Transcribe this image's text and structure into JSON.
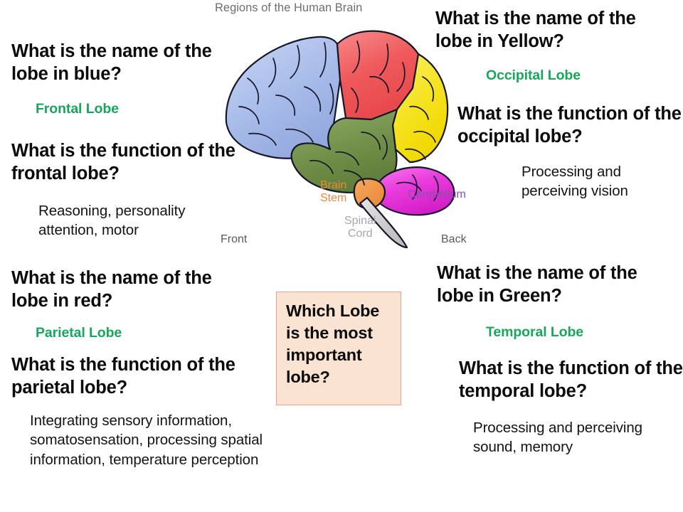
{
  "figure": {
    "title": "Regions of the Human Brain",
    "labels": {
      "brain_stem": "Brain\nStem",
      "brain_stem_line1": "Brain",
      "brain_stem_line2": "Stem",
      "spinal_cord_line1": "Spinal",
      "spinal_cord_line2": "Cord",
      "cerebellum": "Cerebellum",
      "front": "Front",
      "back": "Back"
    },
    "colors": {
      "frontal_lobe": "#a8bdea",
      "parietal_lobe": "#ef5a5c",
      "occipital_lobe": "#f6e426",
      "temporal_lobe": "#72914a",
      "cerebellum": "#ea3ede",
      "brain_stem": "#f0943f",
      "spinal_cord": "#cfcfcf",
      "outline": "#1a1a2e"
    }
  },
  "accent_colors": {
    "answer_green": "#16a75c",
    "callout_bg": "#fbe3d2",
    "callout_border": "#e8a294"
  },
  "left_column": {
    "blocks": [
      {
        "question": "What is the name of the lobe in blue?",
        "answer": "Frontal Lobe",
        "answer_kind": "lobe-name"
      },
      {
        "question": "What is the function of the frontal lobe?",
        "answer": "Reasoning, personality attention, motor",
        "answer_kind": "function"
      },
      {
        "question": "What is the name of the lobe in red?",
        "answer": "Parietal Lobe",
        "answer_kind": "lobe-name"
      },
      {
        "question": "What is the function of the parietal lobe?",
        "answer": "Integrating sensory information, somatosensation, processing spatial information, temperature perception",
        "answer_kind": "function"
      }
    ]
  },
  "right_column": {
    "blocks": [
      {
        "question": "What is the name of the lobe in Yellow?",
        "answer": "Occipital Lobe",
        "answer_kind": "lobe-name"
      },
      {
        "question": "What is the function of the occipital lobe?",
        "answer": "Processing and perceiving vision",
        "answer_kind": "function"
      },
      {
        "question": "What is the name of the lobe in Green?",
        "answer": "Temporal Lobe",
        "answer_kind": "lobe-name"
      },
      {
        "question": "What is the function of the temporal lobe?",
        "answer": "Processing and perceiving sound, memory",
        "answer_kind": "function"
      }
    ]
  },
  "callout": {
    "text": "Which Lobe is the most important lobe?"
  }
}
